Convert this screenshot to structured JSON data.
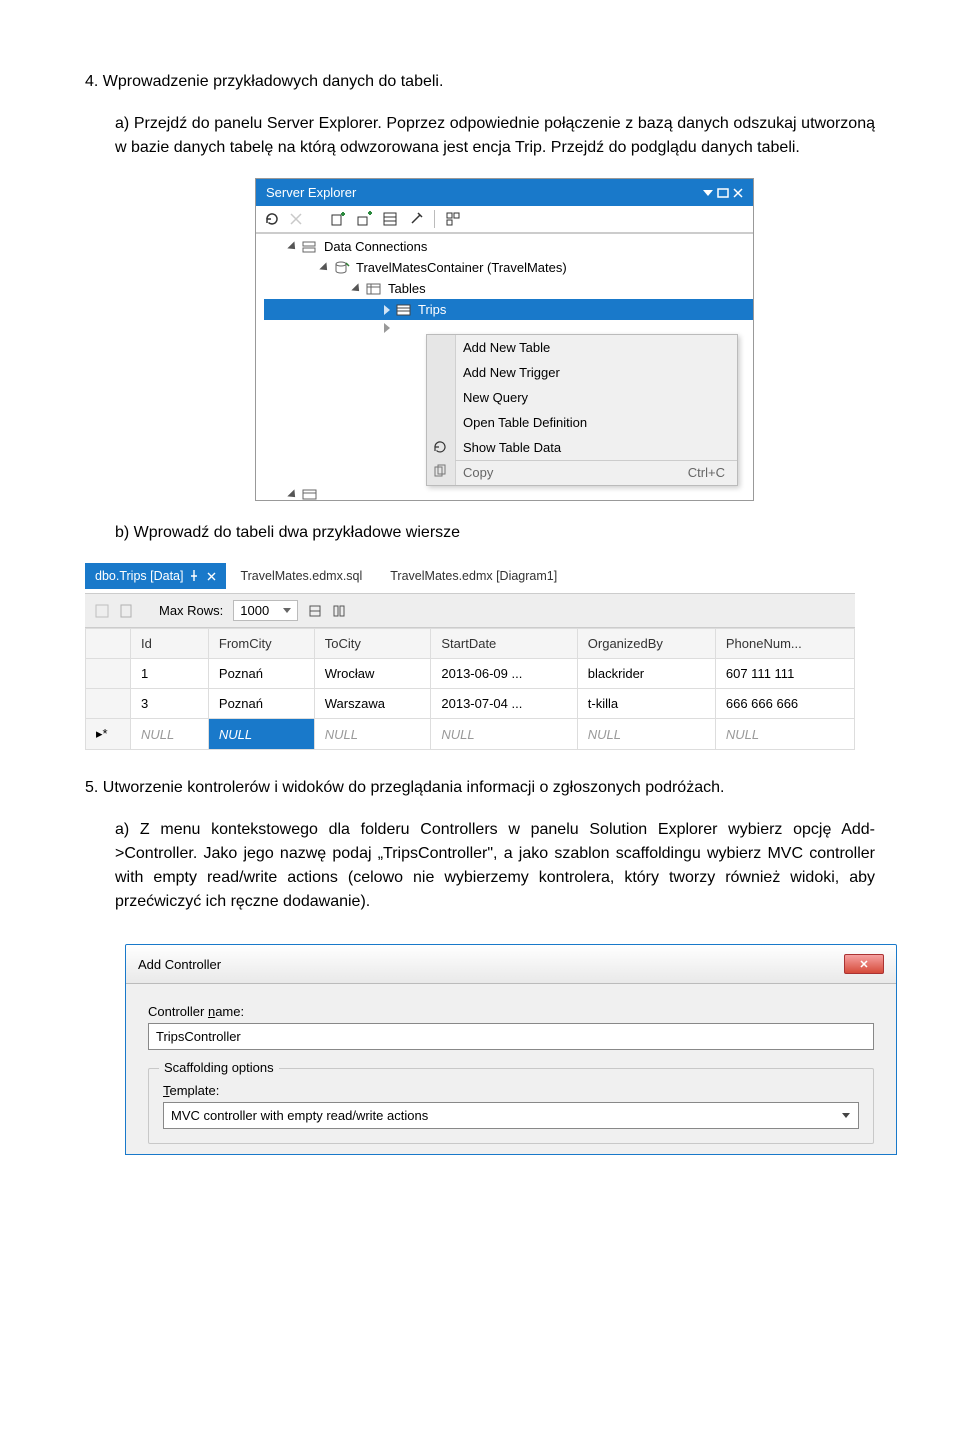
{
  "section4": "4. Wprowadzenie przykładowych danych do tabeli.",
  "p4a": "a)  Przejdź do panelu Server Explorer. Poprzez odpowiednie połączenie z bazą danych odszukaj utworzoną w bazie danych tabelę na którą odwzorowana jest encja Trip. Przejdź do podglądu danych tabeli.",
  "serverExplorer": {
    "title": "Server Explorer",
    "tree": {
      "dataConnections": "Data Connections",
      "conn": "TravelMatesContainer (TravelMates)",
      "tables": "Tables",
      "trips": "Trips"
    },
    "ctx": {
      "addTable": "Add New Table",
      "addTrigger": "Add New Trigger",
      "newQuery": "New Query",
      "openDef": "Open Table Definition",
      "showData": "Show Table Data",
      "copy": "Copy",
      "copyShort": "Ctrl+C"
    }
  },
  "p4b": "b)  Wprowadź do tabeli dwa przykładowe wiersze",
  "gridTabs": {
    "active": "dbo.Trips [Data]",
    "t2": "TravelMates.edmx.sql",
    "t3": "TravelMates.edmx [Diagram1]"
  },
  "gridToolbar": {
    "maxRows": "Max Rows:",
    "maxRowsVal": "1000"
  },
  "gridCols": [
    "Id",
    "FromCity",
    "ToCity",
    "StartDate",
    "OrganizedBy",
    "PhoneNum..."
  ],
  "gridRows": [
    {
      "Id": "1",
      "FromCity": "Poznań",
      "ToCity": "Wrocław",
      "StartDate": "2013-06-09 ...",
      "OrganizedBy": "blackrider",
      "PhoneNum": "607 111 111"
    },
    {
      "Id": "3",
      "FromCity": "Poznań",
      "ToCity": "Warszawa",
      "StartDate": "2013-07-04 ...",
      "OrganizedBy": "t-killa",
      "PhoneNum": "666 666 666"
    }
  ],
  "nullLabel": "NULL",
  "section5": "5. Utworzenie kontrolerów i widoków do przeglądania informacji o zgłoszonych podróżach.",
  "p5a": "a)  Z menu kontekstowego dla folderu Controllers w panelu Solution Explorer wybierz opcję  Add->Controller. Jako jego nazwę podaj „TripsController\", a jako szablon scaffoldingu wybierz MVC controller with empty read/write actions (celowo nie wybierzemy kontrolera, który tworzy również widoki, aby przećwiczyć ich ręczne dodawanie).",
  "dlg": {
    "title": "Add Controller",
    "nameLabel": "Controller name:",
    "nameUnderline": "n",
    "nameVal": "TripsController",
    "group": "Scaffolding options",
    "tplLabel": "Template:",
    "tplUnderline": "T",
    "tplVal": "MVC controller with empty read/write actions"
  }
}
